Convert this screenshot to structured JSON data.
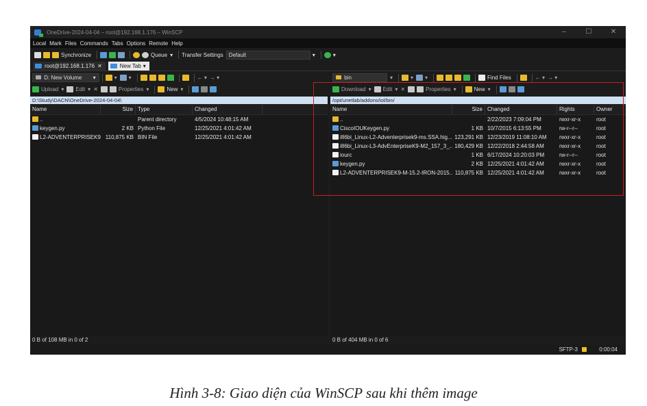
{
  "window": {
    "title": "OneDrive-2024-04-04 – root@192.168.1.176 – WinSCP"
  },
  "menu": [
    "Local",
    "Mark",
    "Files",
    "Commands",
    "Tabs",
    "Options",
    "Remote",
    "Help"
  ],
  "toolbar": {
    "synchronize": "Synchronize",
    "queue": "Queue",
    "transfer_settings": "Transfer Settings",
    "transfer_preset": "Default"
  },
  "tabs": {
    "session": "root@192.168.1.176",
    "new_tab": "New Tab"
  },
  "left": {
    "drive": "D: New Volume",
    "actions": {
      "upload": "Upload",
      "edit": "Edit",
      "properties": "Properties",
      "new": "New"
    },
    "path": "D:\\Study\\DACN\\OneDrive-2024-04-04\\",
    "headers": {
      "name": "Name",
      "size": "Size",
      "type": "Type",
      "changed": "Changed"
    },
    "files": [
      {
        "name": "..",
        "size": "",
        "type": "Parent directory",
        "changed": "4/5/2024 10:48:15 AM",
        "icon": "folder"
      },
      {
        "name": "keygen.py",
        "size": "2 KB",
        "type": "Python File",
        "changed": "12/25/2021 4:01:42 AM",
        "icon": "python"
      },
      {
        "name": "L2-ADVENTERPRISEK9...",
        "size": "110,875 KB",
        "type": "BIN File",
        "changed": "12/25/2021 4:01:42 AM",
        "icon": "file"
      }
    ],
    "status": "0 B of 108 MB in 0 of 2"
  },
  "right": {
    "dir": "bin",
    "find_files": "Find Files",
    "actions": {
      "download": "Download",
      "edit": "Edit",
      "properties": "Properties",
      "new": "New"
    },
    "path": "/opt/unetlab/addons/iol/bin/",
    "headers": {
      "name": "Name",
      "size": "Size",
      "changed": "Changed",
      "rights": "Rights",
      "owner": "Owner"
    },
    "files": [
      {
        "name": "..",
        "size": "",
        "changed": "2/22/2023 7:09:04 PM",
        "rights": "rwxr-xr-x",
        "owner": "root",
        "icon": "folder"
      },
      {
        "name": "CiscoIOUKeygen.py",
        "size": "1 KB",
        "changed": "10/7/2015 6:13:55 PM",
        "rights": "rw-r--r--",
        "owner": "root",
        "icon": "python"
      },
      {
        "name": "i86bi_Linux-L2-Adventerprisek9-ms.SSA.hig...",
        "size": "123,291 KB",
        "changed": "12/23/2019 11:08:10 AM",
        "rights": "rwxr-xr-x",
        "owner": "root",
        "icon": "file"
      },
      {
        "name": "i86bi_Linux-L3-AdvEnterpriseK9-M2_157_3_...",
        "size": "180,429 KB",
        "changed": "12/22/2018 2:44:58 AM",
        "rights": "rwxr-xr-x",
        "owner": "root",
        "icon": "file"
      },
      {
        "name": "iourc",
        "size": "1 KB",
        "changed": "6/17/2024 10:20:03 PM",
        "rights": "rw-r--r--",
        "owner": "root",
        "icon": "file"
      },
      {
        "name": "keygen.py",
        "size": "2 KB",
        "changed": "12/25/2021 4:01:42 AM",
        "rights": "rwxr-xr-x",
        "owner": "root",
        "icon": "python"
      },
      {
        "name": "L2-ADVENTERPRISEK9-M-15.2-IRON-2015...",
        "size": "110,875 KB",
        "changed": "12/25/2021 4:01:42 AM",
        "rights": "rwxr-xr-x",
        "owner": "root",
        "icon": "file"
      }
    ],
    "status": "0 B of 404 MB in 0 of 6"
  },
  "bottom": {
    "protocol": "SFTP-3",
    "timer": "0:00:04"
  },
  "caption": "Hình 3-8: Giao diện của WinSCP sau khi thêm image"
}
